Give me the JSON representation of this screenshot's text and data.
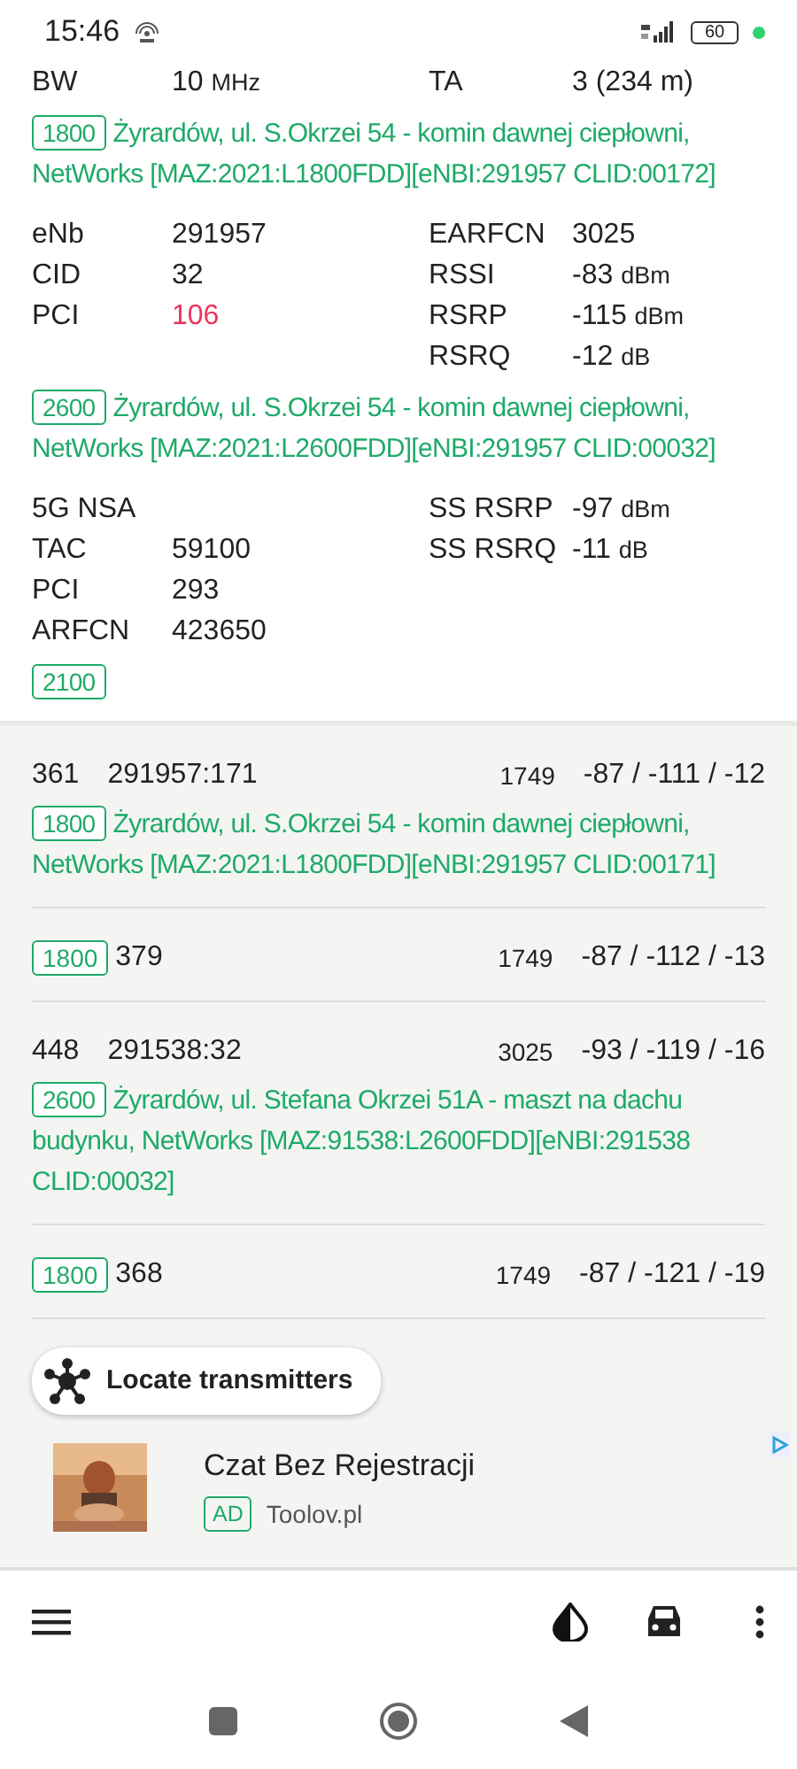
{
  "status_bar": {
    "time": "15:46",
    "battery": "60"
  },
  "serving": [
    {
      "kind": "grid",
      "rows": [
        {
          "left": {
            "label": "BW",
            "value": "10",
            "unit": "MHz",
            "warning": false
          },
          "right": {
            "label": "TA",
            "value": "3 (234 m)",
            "warning": false
          }
        }
      ]
    },
    {
      "kind": "site",
      "band": "1800",
      "text": "Żyrardów, ul. S.Okrzei 54 - komin dawnej ciepłowni, NetWorks [MAZ:2021:L1800FDD][eNBI:291957 CLID:00172]"
    },
    {
      "kind": "grid",
      "rows": [
        {
          "left": {
            "label": "eNb",
            "value": "291957",
            "warning": false
          },
          "right": {
            "label": "EARFCN",
            "value": "3025",
            "warning": false
          }
        },
        {
          "left": {
            "label": "CID",
            "value": "32",
            "warning": false
          },
          "right": {
            "label": "RSSI",
            "value": "-83",
            "unit": "dBm",
            "warning": false
          }
        },
        {
          "left": {
            "label": "PCI",
            "value": "106",
            "warning": true
          },
          "right": {
            "label": "RSRP",
            "value": "-115",
            "unit": "dBm",
            "warning": false
          }
        },
        {
          "right": {
            "label": "RSRQ",
            "value": "-12",
            "unit": "dB",
            "warning": false
          }
        }
      ]
    },
    {
      "kind": "site",
      "band": "2600",
      "text": "Żyrardów, ul. S.Okrzei 54 - komin dawnej ciepłowni, NetWorks [MAZ:2021:L2600FDD][eNBI:291957 CLID:00032]"
    },
    {
      "kind": "grid",
      "rows": [
        {
          "left": {
            "label": "5G NSA"
          },
          "right": {
            "label": "SS RSRP",
            "value": "-97",
            "unit": "dBm",
            "warning": false
          }
        },
        {
          "left": {
            "label": "TAC",
            "value": "59100",
            "warning": false
          },
          "right": {
            "label": "SS RSRQ",
            "value": "-11",
            "unit": "dB",
            "warning": false
          }
        },
        {
          "left": {
            "label": "PCI",
            "value": "293",
            "warning": false
          }
        },
        {
          "left": {
            "label": "ARFCN",
            "value": "423650",
            "warning": false
          }
        }
      ]
    },
    {
      "kind": "site",
      "band": "2100"
    }
  ],
  "neighbours": [
    {
      "pci": "361",
      "cell_id": "291957:171",
      "earfcn": "1749",
      "signal": "-87 / -111 / -12",
      "site": {
        "band": "1800",
        "text": "Żyrardów, ul. S.Okrzei 54 - komin dawnej ciepłowni, NetWorks [MAZ:2021:L1800FDD][eNBI:291957 CLID:00171]"
      }
    },
    {
      "band": "1800",
      "pci": "379",
      "earfcn": "1749",
      "signal": "-87 / -112 / -13"
    },
    {
      "pci": "448",
      "cell_id": "291538:32",
      "earfcn": "3025",
      "signal": "-93 / -119 / -16",
      "site": {
        "band": "2600",
        "text": "Żyrardów, ul. Stefana Okrzei 51A - maszt na dachu budynku, NetWorks [MAZ:91538:L2600FDD][eNBI:291538 CLID:00032]"
      }
    },
    {
      "band": "1800",
      "pci": "368",
      "earfcn": "1749",
      "signal": "-87 / -121 / -19"
    }
  ],
  "locate_button": "Locate transmitters",
  "ad": {
    "title": "Czat Bez Rejestracji",
    "badge": "AD",
    "source": "Toolov.pl"
  }
}
